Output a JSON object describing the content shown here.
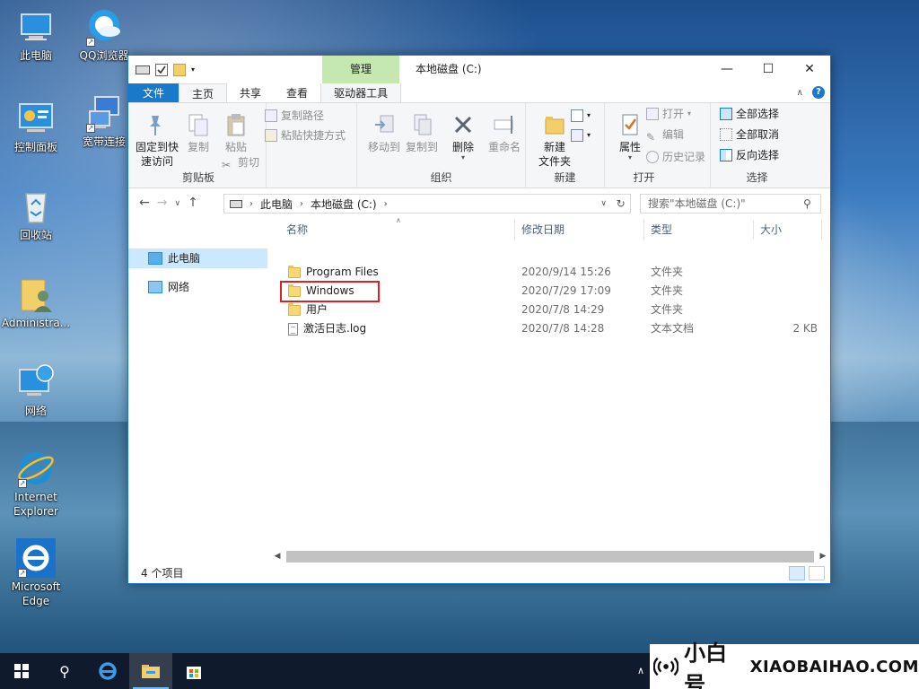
{
  "desktop": {
    "icons": [
      {
        "label": "此电脑"
      },
      {
        "label": "QQ浏览器"
      },
      {
        "label": "控制面板"
      },
      {
        "label": "宽带连接"
      },
      {
        "label": "回收站"
      },
      {
        "label": "Administra..."
      },
      {
        "label": "网络"
      },
      {
        "label": "Internet Explorer"
      },
      {
        "label": "Microsoft Edge"
      }
    ]
  },
  "window": {
    "title": "本地磁盘 (C:)",
    "context_tab": "管理",
    "tabs": {
      "file": "文件",
      "home": "主页",
      "share": "共享",
      "view": "查看",
      "drive_tools": "驱动器工具"
    },
    "ribbon": {
      "clipboard": {
        "label": "剪贴板",
        "pin": "固定到快速访问",
        "copy": "复制",
        "paste": "粘贴",
        "copy_path": "复制路径",
        "paste_shortcut": "粘贴快捷方式",
        "cut": "剪切"
      },
      "organize": {
        "label": "组织",
        "move_to": "移动到",
        "copy_to": "复制到",
        "delete": "删除",
        "rename": "重命名"
      },
      "new": {
        "label": "新建",
        "new_folder": "新建\n文件夹"
      },
      "open": {
        "label": "打开",
        "properties": "属性",
        "open": "打开",
        "edit": "编辑",
        "history": "历史记录"
      },
      "select": {
        "label": "选择",
        "select_all": "全部选择",
        "select_none": "全部取消",
        "invert": "反向选择"
      }
    },
    "address": {
      "crumbs": [
        "此电脑",
        "本地磁盘 (C:)"
      ]
    },
    "search": {
      "placeholder": "搜索\"本地磁盘 (C:)\""
    },
    "nav": {
      "this_pc": "此电脑",
      "network": "网络"
    },
    "columns": {
      "name": "名称",
      "date": "修改日期",
      "type": "类型",
      "size": "大小"
    },
    "files": [
      {
        "name": "Program Files",
        "date": "2020/9/14 15:26",
        "type": "文件夹",
        "size": "",
        "kind": "folder"
      },
      {
        "name": "Windows",
        "date": "2020/7/29 17:09",
        "type": "文件夹",
        "size": "",
        "kind": "folder",
        "highlighted": true
      },
      {
        "name": "用户",
        "date": "2020/7/8 14:29",
        "type": "文件夹",
        "size": "",
        "kind": "folder"
      },
      {
        "name": "激活日志.log",
        "date": "2020/7/8 14:28",
        "type": "文本文档",
        "size": "2 KB",
        "kind": "file"
      }
    ],
    "status": "4 个项目"
  },
  "watermark": {
    "cn": "小白号",
    "en": "XIAOBAIHAO.COM"
  },
  "colors": {
    "accent": "#1979ca",
    "manage_tab": "#c5e8b0",
    "selected_nav": "#cce8ff",
    "highlight_box": "#e02020"
  }
}
